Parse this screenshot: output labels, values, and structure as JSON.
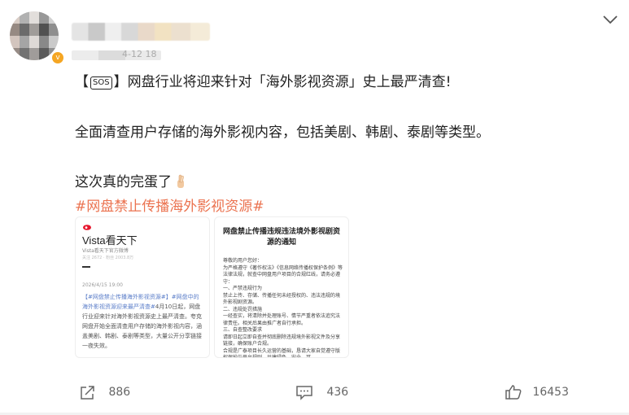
{
  "post": {
    "line1_prefix": "【",
    "line1_sos": "🆘",
    "line1_text": "网盘行业将迎来针对「海外影视资源」史上最严清查!",
    "line1_open": "【",
    "line1_sos_label": "SOS",
    "line1_close": "】",
    "line2": "全面清查用户存储的海外影视内容，包括美剧、韩剧、泰剧等类型。",
    "line3": "这次真的完蛋了",
    "line3_emoji": "crossed-fingers-icon",
    "hashtag": "#网盘禁止传播海外影视资源#"
  },
  "author": {
    "time_fragment": "4-12 18"
  },
  "images": {
    "left": {
      "title": "Vista看天下",
      "subtitle": "Vista看天下官方微博",
      "meta": "关注 2672 · 粉丝 2003.8万",
      "date": "2026/4/15 19:00",
      "body_hl": "【#网盘禁止传播海外影视资源#】#网盘中的海外影视资源迎来最严清查#",
      "body": "4月10日起，网盘行业迎来针对海外影视资源史上最严清查。夸克网盘开始全面清查用户存储的海外影视内容，涵盖美剧、韩剧、泰剧等类型，大量公开分享链接一夜失效。"
    },
    "right": {
      "title": "网盘禁止传播违规违法境外影视剧资源的通知",
      "body": "尊敬的用户您好：\n为严格遵守《著作权法》《信息网络传播权保护条例》等法律法规，就查中网盘用户项目的合规红线，请务必遵守：\n一、严禁违规行为\n禁止上传、存储、传播任何未经授权的、违法违规的境外影视剧资源。\n二、违规处罚措施\n一经查实，将清除并处理账号、情节严重者依法追究法律责任。相关后果由推广者自行承担。\n三、自查整改要求\n请即日起立即自查并彻底删除违规境外影视文件及分享链接，确保账户合规。\n合规是广泰项目长久运营的基础，恳请大家自觉遵守版权保护与平台规则，共建绿色、安全、可"
    }
  },
  "actions": {
    "repost_count": "886",
    "comment_count": "436",
    "like_count": "16453"
  },
  "colors": {
    "hashtag": "#eb7350",
    "badge": "#f5a623"
  }
}
